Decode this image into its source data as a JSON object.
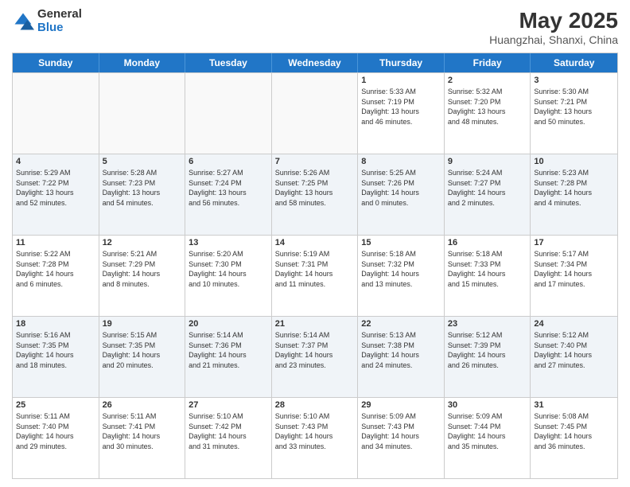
{
  "logo": {
    "general": "General",
    "blue": "Blue"
  },
  "title": "May 2025",
  "subtitle": "Huangzhai, Shanxi, China",
  "headers": [
    "Sunday",
    "Monday",
    "Tuesday",
    "Wednesday",
    "Thursday",
    "Friday",
    "Saturday"
  ],
  "rows": [
    [
      {
        "day": "",
        "detail": ""
      },
      {
        "day": "",
        "detail": ""
      },
      {
        "day": "",
        "detail": ""
      },
      {
        "day": "",
        "detail": ""
      },
      {
        "day": "1",
        "detail": "Sunrise: 5:33 AM\nSunset: 7:19 PM\nDaylight: 13 hours\nand 46 minutes."
      },
      {
        "day": "2",
        "detail": "Sunrise: 5:32 AM\nSunset: 7:20 PM\nDaylight: 13 hours\nand 48 minutes."
      },
      {
        "day": "3",
        "detail": "Sunrise: 5:30 AM\nSunset: 7:21 PM\nDaylight: 13 hours\nand 50 minutes."
      }
    ],
    [
      {
        "day": "4",
        "detail": "Sunrise: 5:29 AM\nSunset: 7:22 PM\nDaylight: 13 hours\nand 52 minutes."
      },
      {
        "day": "5",
        "detail": "Sunrise: 5:28 AM\nSunset: 7:23 PM\nDaylight: 13 hours\nand 54 minutes."
      },
      {
        "day": "6",
        "detail": "Sunrise: 5:27 AM\nSunset: 7:24 PM\nDaylight: 13 hours\nand 56 minutes."
      },
      {
        "day": "7",
        "detail": "Sunrise: 5:26 AM\nSunset: 7:25 PM\nDaylight: 13 hours\nand 58 minutes."
      },
      {
        "day": "8",
        "detail": "Sunrise: 5:25 AM\nSunset: 7:26 PM\nDaylight: 14 hours\nand 0 minutes."
      },
      {
        "day": "9",
        "detail": "Sunrise: 5:24 AM\nSunset: 7:27 PM\nDaylight: 14 hours\nand 2 minutes."
      },
      {
        "day": "10",
        "detail": "Sunrise: 5:23 AM\nSunset: 7:28 PM\nDaylight: 14 hours\nand 4 minutes."
      }
    ],
    [
      {
        "day": "11",
        "detail": "Sunrise: 5:22 AM\nSunset: 7:28 PM\nDaylight: 14 hours\nand 6 minutes."
      },
      {
        "day": "12",
        "detail": "Sunrise: 5:21 AM\nSunset: 7:29 PM\nDaylight: 14 hours\nand 8 minutes."
      },
      {
        "day": "13",
        "detail": "Sunrise: 5:20 AM\nSunset: 7:30 PM\nDaylight: 14 hours\nand 10 minutes."
      },
      {
        "day": "14",
        "detail": "Sunrise: 5:19 AM\nSunset: 7:31 PM\nDaylight: 14 hours\nand 11 minutes."
      },
      {
        "day": "15",
        "detail": "Sunrise: 5:18 AM\nSunset: 7:32 PM\nDaylight: 14 hours\nand 13 minutes."
      },
      {
        "day": "16",
        "detail": "Sunrise: 5:18 AM\nSunset: 7:33 PM\nDaylight: 14 hours\nand 15 minutes."
      },
      {
        "day": "17",
        "detail": "Sunrise: 5:17 AM\nSunset: 7:34 PM\nDaylight: 14 hours\nand 17 minutes."
      }
    ],
    [
      {
        "day": "18",
        "detail": "Sunrise: 5:16 AM\nSunset: 7:35 PM\nDaylight: 14 hours\nand 18 minutes."
      },
      {
        "day": "19",
        "detail": "Sunrise: 5:15 AM\nSunset: 7:35 PM\nDaylight: 14 hours\nand 20 minutes."
      },
      {
        "day": "20",
        "detail": "Sunrise: 5:14 AM\nSunset: 7:36 PM\nDaylight: 14 hours\nand 21 minutes."
      },
      {
        "day": "21",
        "detail": "Sunrise: 5:14 AM\nSunset: 7:37 PM\nDaylight: 14 hours\nand 23 minutes."
      },
      {
        "day": "22",
        "detail": "Sunrise: 5:13 AM\nSunset: 7:38 PM\nDaylight: 14 hours\nand 24 minutes."
      },
      {
        "day": "23",
        "detail": "Sunrise: 5:12 AM\nSunset: 7:39 PM\nDaylight: 14 hours\nand 26 minutes."
      },
      {
        "day": "24",
        "detail": "Sunrise: 5:12 AM\nSunset: 7:40 PM\nDaylight: 14 hours\nand 27 minutes."
      }
    ],
    [
      {
        "day": "25",
        "detail": "Sunrise: 5:11 AM\nSunset: 7:40 PM\nDaylight: 14 hours\nand 29 minutes."
      },
      {
        "day": "26",
        "detail": "Sunrise: 5:11 AM\nSunset: 7:41 PM\nDaylight: 14 hours\nand 30 minutes."
      },
      {
        "day": "27",
        "detail": "Sunrise: 5:10 AM\nSunset: 7:42 PM\nDaylight: 14 hours\nand 31 minutes."
      },
      {
        "day": "28",
        "detail": "Sunrise: 5:10 AM\nSunset: 7:43 PM\nDaylight: 14 hours\nand 33 minutes."
      },
      {
        "day": "29",
        "detail": "Sunrise: 5:09 AM\nSunset: 7:43 PM\nDaylight: 14 hours\nand 34 minutes."
      },
      {
        "day": "30",
        "detail": "Sunrise: 5:09 AM\nSunset: 7:44 PM\nDaylight: 14 hours\nand 35 minutes."
      },
      {
        "day": "31",
        "detail": "Sunrise: 5:08 AM\nSunset: 7:45 PM\nDaylight: 14 hours\nand 36 minutes."
      }
    ]
  ]
}
